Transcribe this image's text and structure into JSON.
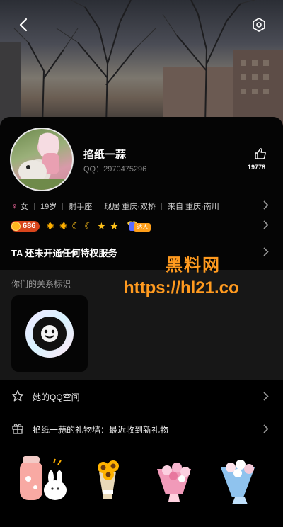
{
  "header": {
    "back_icon": "back-arrow-icon",
    "settings_icon": "hexagon-settings-icon"
  },
  "profile": {
    "name": "掐纸一蒜",
    "qq": "QQ：2970475296",
    "like_count": "19778"
  },
  "info": {
    "gender": "女",
    "age": "19岁",
    "zodiac": "射手座",
    "lives": "现居 重庆·双桥",
    "from": "来自 重庆·南川"
  },
  "level": "686",
  "daren_label": "达人",
  "privilege_text": "TA 还未开通任何特权服务",
  "relation": {
    "title": "你们的关系标识"
  },
  "rows": {
    "qzone": "她的QQ空间",
    "giftwall": "掐纸一蒜的礼物墙：最近收到新礼物"
  },
  "watermark": {
    "line1": "黑料网",
    "line2": "https://hl21.co"
  },
  "colors": {
    "accent": "#ff9a1f",
    "level_badge": "#d8451c"
  }
}
